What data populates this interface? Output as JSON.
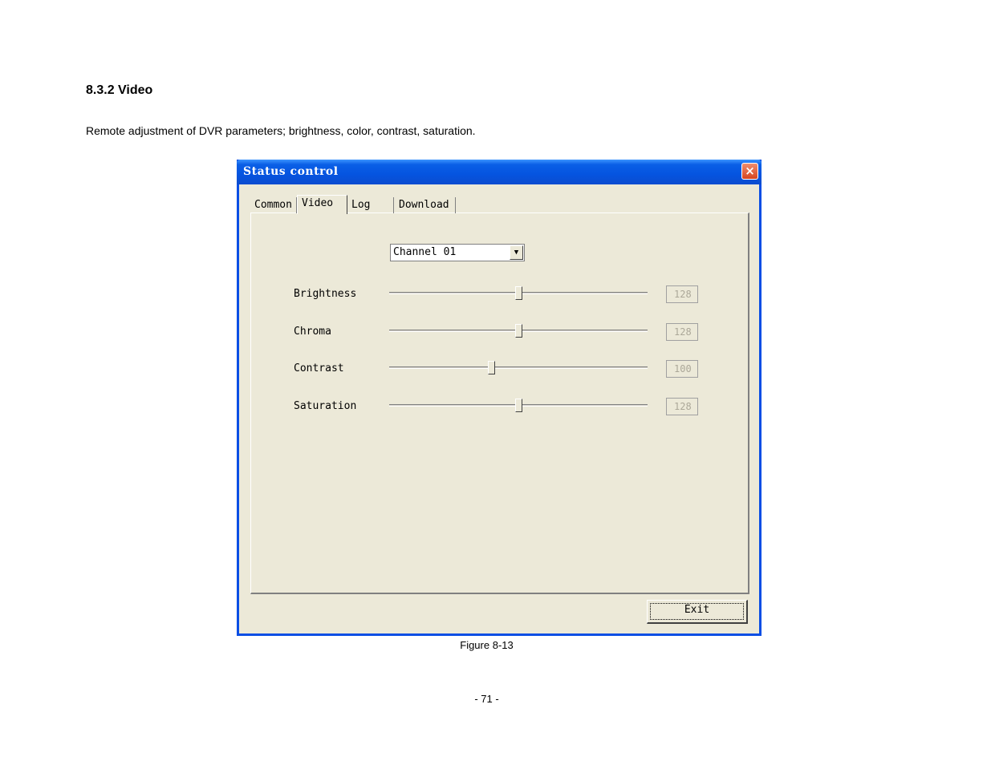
{
  "document": {
    "heading": "8.3.2 Video",
    "intro": "Remote adjustment of DVR parameters; brightness, color, contrast, saturation.",
    "caption": "Figure 8-13",
    "page_number": "- 71 -"
  },
  "window": {
    "title": "Status control",
    "close_icon": "×",
    "tabs": [
      {
        "label": "Common"
      },
      {
        "label": "Video"
      },
      {
        "label": "Log"
      },
      {
        "label": "Download"
      }
    ],
    "active_tab": "Video",
    "channel_select": {
      "value": "Channel 01",
      "arrow_icon": "▼"
    },
    "controls": [
      {
        "label": "Brightness",
        "value": "128",
        "level": 128,
        "max": 255
      },
      {
        "label": "Chroma",
        "value": "128",
        "level": 128,
        "max": 255
      },
      {
        "label": "Contrast",
        "value": "100",
        "level": 100,
        "max": 255
      },
      {
        "label": "Saturation",
        "value": "128",
        "level": 128,
        "max": 255
      }
    ],
    "exit_label": "Exit"
  }
}
